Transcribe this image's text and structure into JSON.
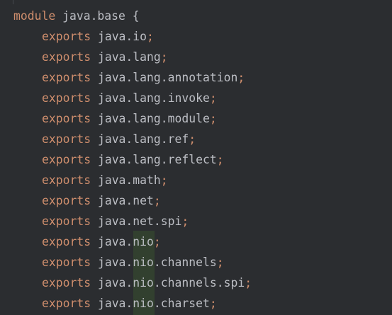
{
  "editor": {
    "module_keyword": "module",
    "module_name": "java.base",
    "open_brace": "{",
    "exports_keyword": "exports",
    "semicolon": ";",
    "packages": [
      "java.io",
      "java.lang",
      "java.lang.annotation",
      "java.lang.invoke",
      "java.lang.module",
      "java.lang.ref",
      "java.lang.reflect",
      "java.math",
      "java.net",
      "java.net.spi",
      "java.nio",
      "java.nio.channels",
      "java.nio.channels.spi",
      "java.nio.charset"
    ]
  },
  "colors": {
    "background": "#2b2d30",
    "keyword": "#cf8e6d",
    "identifier": "#bcbec4",
    "match_highlight": "#32402f"
  }
}
